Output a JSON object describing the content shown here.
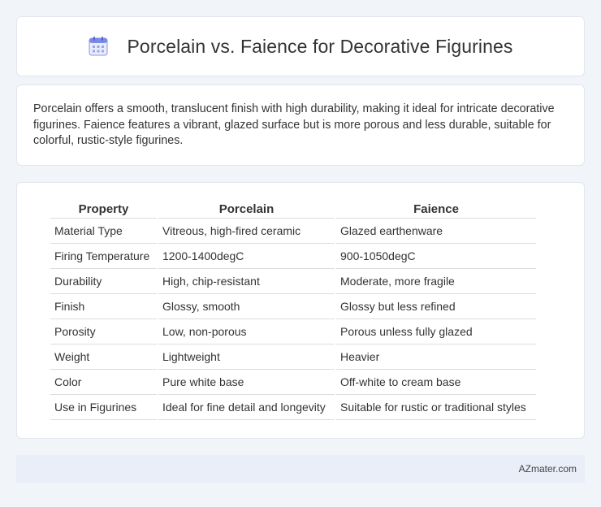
{
  "header": {
    "title": "Porcelain vs. Faience for Decorative Figurines",
    "icon": "calendar-icon",
    "icon_color": "#6c7ee1"
  },
  "summary": {
    "text": "Porcelain offers a smooth, translucent finish with high durability, making it ideal for intricate decorative figurines. Faience features a vibrant, glazed surface but is more porous and less durable, suitable for colorful, rustic-style figurines."
  },
  "table": {
    "headers": [
      "Property",
      "Porcelain",
      "Faience"
    ],
    "rows": [
      [
        "Material Type",
        "Vitreous, high-fired ceramic",
        "Glazed earthenware"
      ],
      [
        "Firing Temperature",
        "1200-1400degC",
        "900-1050degC"
      ],
      [
        "Durability",
        "High, chip-resistant",
        "Moderate, more fragile"
      ],
      [
        "Finish",
        "Glossy, smooth",
        "Glossy but less refined"
      ],
      [
        "Porosity",
        "Low, non-porous",
        "Porous unless fully glazed"
      ],
      [
        "Weight",
        "Lightweight",
        "Heavier"
      ],
      [
        "Color",
        "Pure white base",
        "Off-white to cream base"
      ],
      [
        "Use in Figurines",
        "Ideal for fine detail and longevity",
        "Suitable for rustic or traditional styles"
      ]
    ]
  },
  "footer": {
    "brand": "AZmater.com"
  }
}
